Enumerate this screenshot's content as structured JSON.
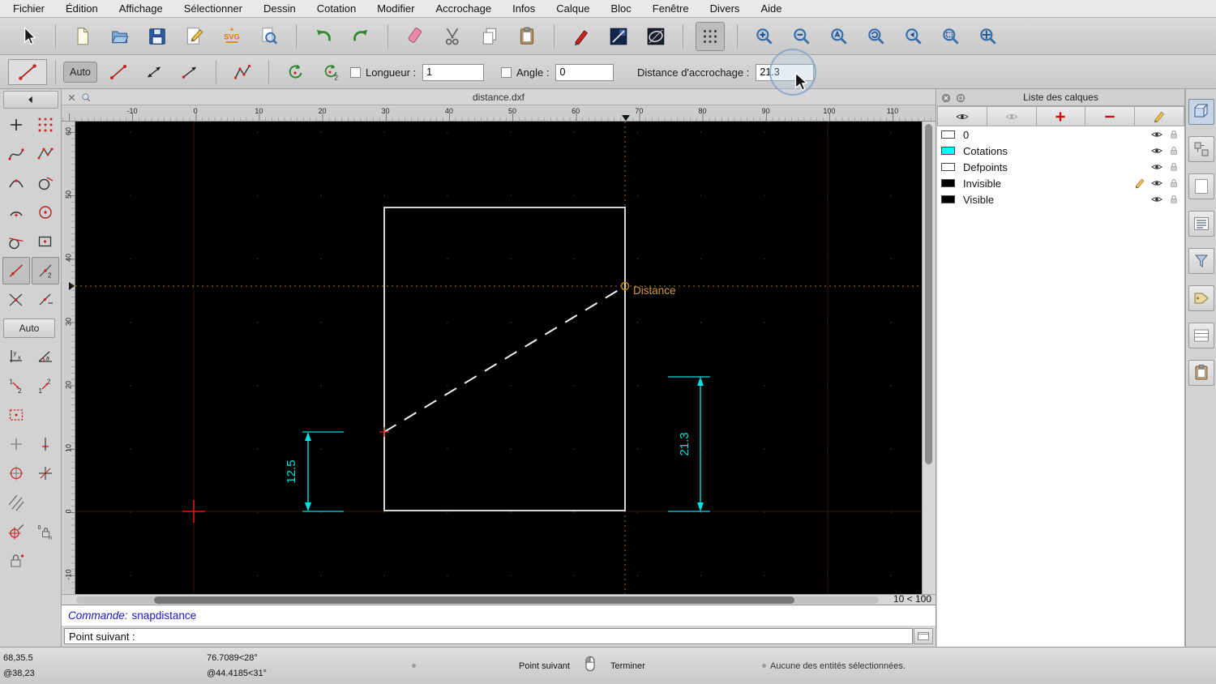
{
  "menubar": {
    "items": [
      "Fichier",
      "Édition",
      "Affichage",
      "Sélectionner",
      "Dessin",
      "Cotation",
      "Modifier",
      "Accrochage",
      "Infos",
      "Calque",
      "Bloc",
      "Fenêtre",
      "Divers",
      "Aide"
    ]
  },
  "toolbar_main": {
    "active": "grid-icon",
    "groups": [
      [
        "select-arrow-icon"
      ],
      [
        "new-file-icon",
        "open-file-icon",
        "save-icon",
        "edit-drawing-icon",
        "svg-export-icon",
        "print-preview-icon"
      ],
      [
        "undo-icon",
        "redo-icon"
      ],
      [
        "delete-icon",
        "cut-icon",
        "copy-icon",
        "paste-icon"
      ],
      [
        "pen-icon",
        "line-attributes-icon",
        "ellipse-icon"
      ],
      [
        "grid-icon"
      ],
      [
        "zoom-in-icon",
        "zoom-out-icon",
        "zoom-auto-icon",
        "zoom-redraw-icon",
        "zoom-previous-icon",
        "zoom-window-icon",
        "zoom-pan-icon"
      ]
    ]
  },
  "toolbar_options": {
    "docked_tool_icon": "line-free-icon",
    "auto_button": "Auto",
    "tools": [
      "line-free-icon",
      "line-both-arrows-icon",
      "line-one-arrow-icon",
      "polyline-icon",
      "rotate-ccw-icon",
      "rotate-two-icon"
    ],
    "length_label": "Longueur :",
    "length_value": "1",
    "angle_label": "Angle :",
    "angle_value": "0",
    "snap_distance_label": "Distance d'accrochage :",
    "snap_distance_value": "21.3"
  },
  "left_palette": {
    "rows": [
      [
        {
          "icon": "point-plus-icon"
        },
        {
          "icon": "point-grid-icon"
        }
      ],
      [
        {
          "icon": "spline-icon"
        },
        {
          "icon": "polyline-points-icon"
        }
      ],
      [
        {
          "icon": "arc-tools-icon"
        },
        {
          "icon": "circle-tools-icon"
        }
      ],
      [
        {
          "icon": "arc-center-icon"
        },
        {
          "icon": "circle-center-icon"
        }
      ],
      [
        {
          "icon": "tangent-line-icon"
        },
        {
          "icon": "rect-point-icon"
        }
      ],
      [
        {
          "icon": "snap-free-icon",
          "active": true
        },
        {
          "icon": "snap-middle-icon",
          "active": true
        }
      ],
      [
        {
          "icon": "snap-intersection-icon"
        },
        {
          "icon": "snap-angle-icon"
        }
      ],
      [
        {
          "label": "Auto"
        }
      ],
      [
        {
          "icon": "coord-cartesian-icon"
        },
        {
          "icon": "coord-polar-icon"
        }
      ],
      [
        {
          "icon": "order-down-icon"
        },
        {
          "icon": "order-up-icon"
        }
      ],
      [
        {
          "icon": "select-window-icon"
        }
      ],
      [
        {
          "icon": "point-plus-gray-icon"
        },
        {
          "icon": "line-point-icon"
        }
      ],
      [
        {
          "icon": "circle-point-icon"
        },
        {
          "icon": "cross-line-icon"
        }
      ],
      [
        {
          "icon": "hatch-icon"
        }
      ],
      [
        {
          "icon": "snap-target-icon"
        },
        {
          "icon": "restrict-lock-icon"
        }
      ],
      [
        {
          "icon": "lock-relative-icon"
        }
      ]
    ]
  },
  "drawing": {
    "title": "distance.dxf",
    "h_ruler": [
      "-10",
      "0",
      "10",
      "20",
      "30",
      "40",
      "50",
      "60",
      "70",
      "80",
      "90",
      "100",
      "110"
    ],
    "v_ruler": [
      "60",
      "50",
      "40",
      "30",
      "20",
      "10",
      "0",
      "-10"
    ],
    "annotation": "Distance",
    "dim_left": "12.5",
    "dim_right": "21.3",
    "zoom_range": "10 < 100"
  },
  "command": {
    "label": "Commande:",
    "value": "snapdistance",
    "prompt": "Point suivant :"
  },
  "status": {
    "abs": "68,35.5",
    "rel": "@38,23",
    "polar_abs": "76.7089<28°",
    "polar_rel": "@44.4185<31°",
    "left_hint": "Point suivant",
    "right_hint": "Terminer",
    "selection": "Aucune des entités sélectionnées."
  },
  "layer_panel": {
    "title": "Liste des calques",
    "toolbar_icons": [
      "eye-icon",
      "eye-gray-icon",
      "plus-red-icon",
      "minus-red-icon",
      "pencil-icon"
    ],
    "layers": [
      {
        "name": "0",
        "swatch": "#ffffff",
        "pencil": false
      },
      {
        "name": "Cotations",
        "swatch": "#00ffff",
        "pencil": false
      },
      {
        "name": "Defpoints",
        "swatch": "#ffffff",
        "pencil": false
      },
      {
        "name": "Invisible",
        "swatch": "#000000",
        "pencil": true
      },
      {
        "name": "Visible",
        "swatch": "#000000",
        "pencil": false
      }
    ]
  },
  "right_dock": {
    "icons": [
      "panel-3d-icon",
      "panel-block-icon",
      "panel-blank-icon",
      "panel-list-icon",
      "panel-filter-icon",
      "panel-tag-icon",
      "panel-rows-icon",
      "panel-clipboard-icon"
    ]
  },
  "colors": {
    "accent_cyan": "#00e0e0",
    "crosshair_orange": "#a87a00",
    "label_orange": "#d89a3c",
    "command_blue": "#1a16c8",
    "marker_red": "#cc1111"
  }
}
